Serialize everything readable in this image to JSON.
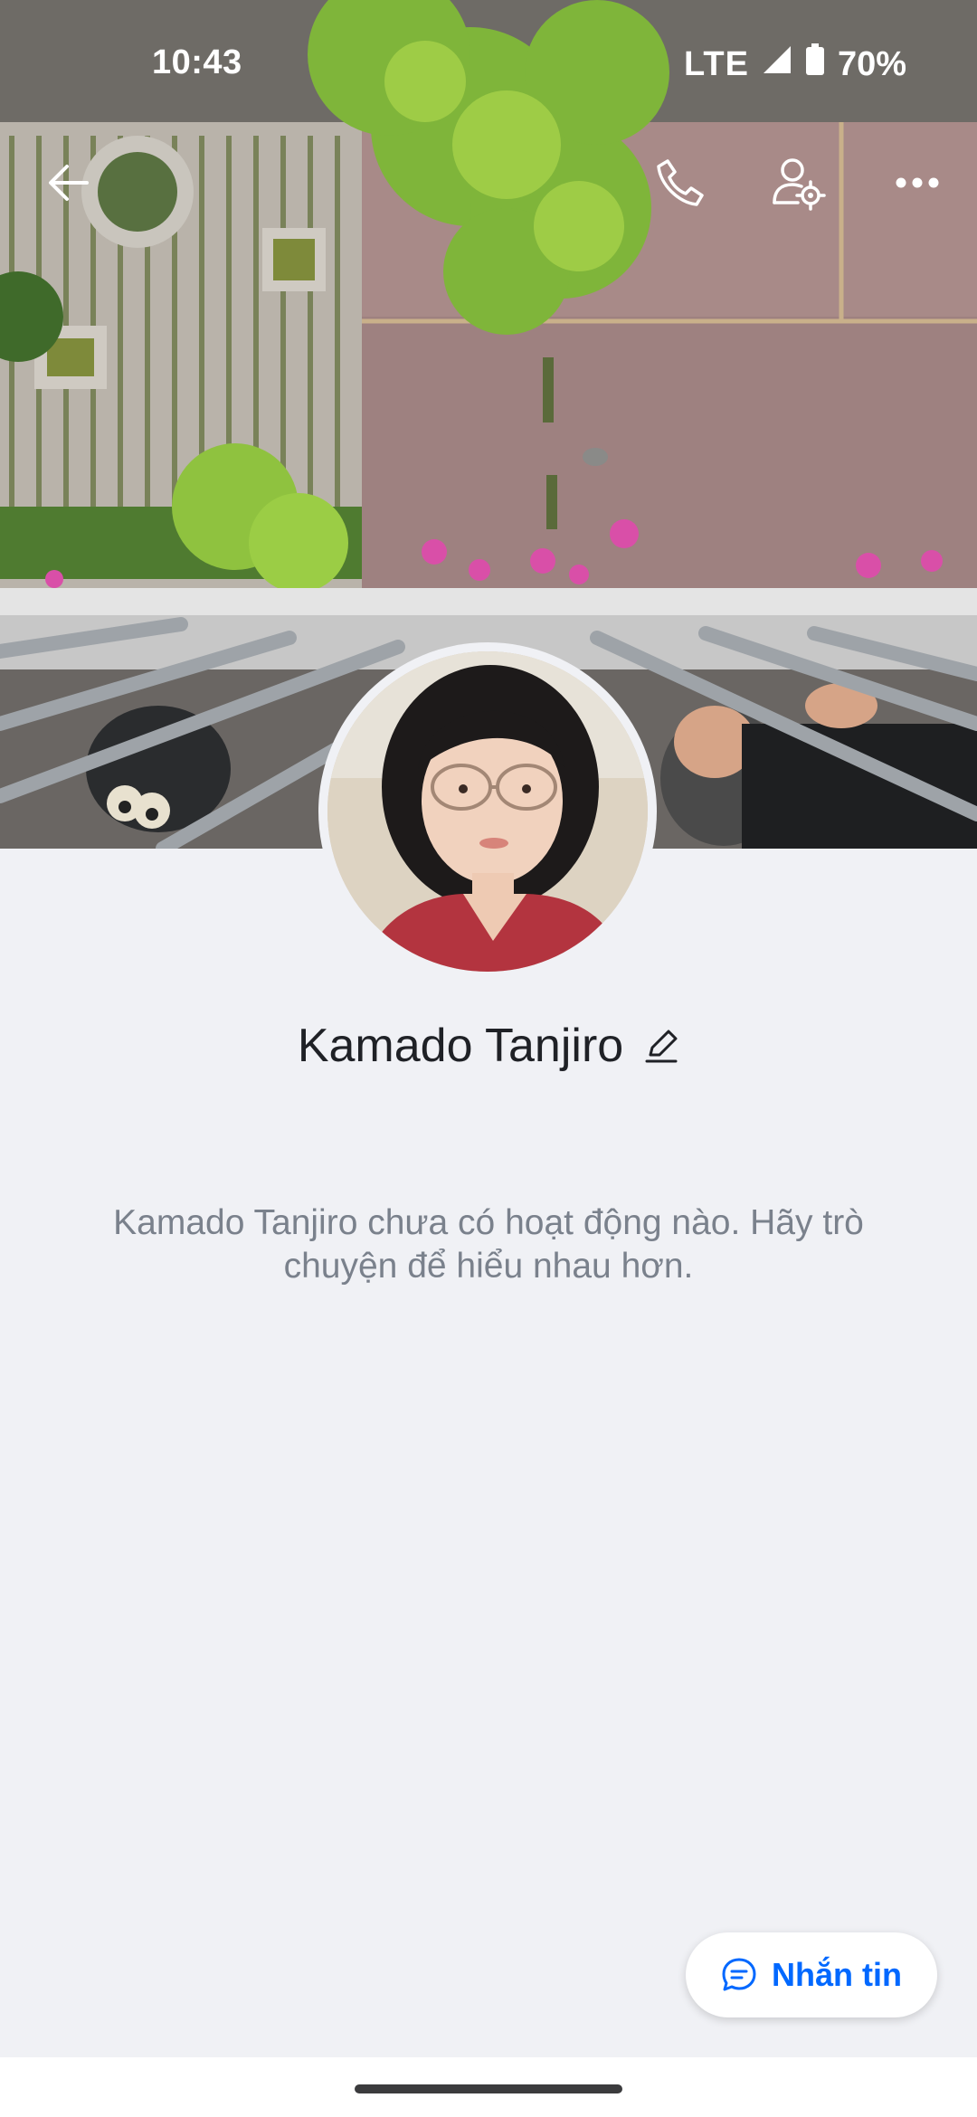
{
  "status_bar": {
    "time": "10:43",
    "network": "LTE",
    "battery": "70%"
  },
  "header": {
    "back_icon": "arrow-left-icon",
    "call_icon": "phone-icon",
    "settings_icon": "user-settings-icon",
    "more_icon": "more-horizontal-icon"
  },
  "profile": {
    "name": "Kamado Tanjiro",
    "edit_icon": "pencil-icon",
    "empty_message": "Kamado Tanjiro chưa có hoạt động nào. Hãy trò chuyện để hiểu nhau hơn."
  },
  "message_button": {
    "label": "Nhắn tin",
    "icon": "chat-bubble-icon"
  },
  "colors": {
    "accent": "#0068ff",
    "background": "#f0f1f5",
    "name_text": "#1f2126",
    "muted_text": "#7a818c"
  }
}
